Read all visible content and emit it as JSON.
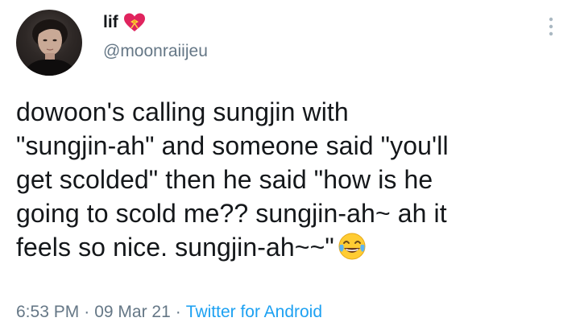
{
  "user": {
    "display_name": "lif",
    "handle": "@moonraiijeu",
    "name_badge_icon": "heart-with-bow-icon"
  },
  "tweet": {
    "text": "dowoon's calling sungjin with\n\"sungjin-ah\" and someone said \"you'll\nget scolded\" then he said \"how is he\ngoing to scold me?? sungjin-ah~ ah it\nfeels so nice. sungjin-ah~~\"",
    "emoji": "face-with-tears-of-joy"
  },
  "meta": {
    "time": "6:53 PM",
    "separator": "·",
    "date": "09 Mar 21",
    "source": "Twitter for Android"
  },
  "icons": {
    "more": "more-vertical-icon"
  },
  "colors": {
    "text": "#14171a",
    "secondary": "#657786",
    "link": "#1da1f2",
    "heart": "#e0245e"
  }
}
